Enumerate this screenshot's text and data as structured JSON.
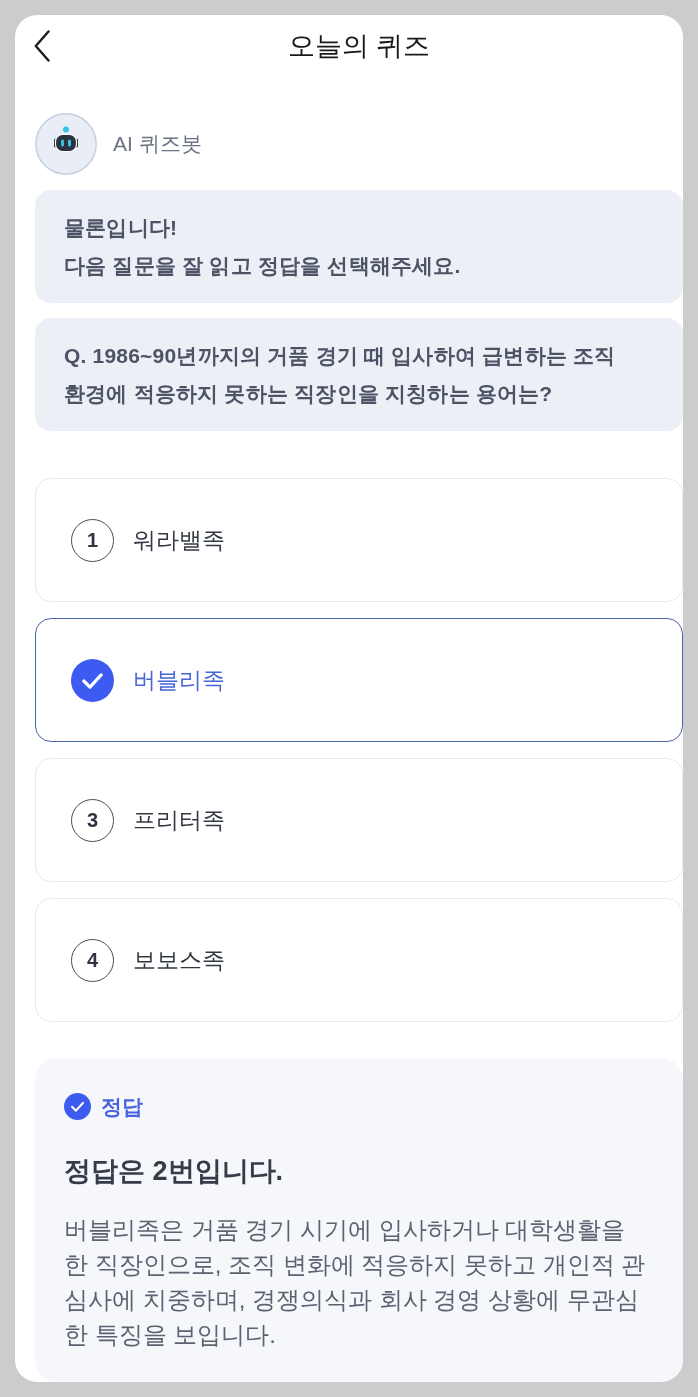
{
  "header": {
    "title": "오늘의 퀴즈"
  },
  "bot": {
    "name": "AI 퀴즈봇"
  },
  "messages": [
    {
      "text": "물론입니다!\n다음 질문을 잘 읽고 정답을 선택해주세요."
    },
    {
      "text": "Q. 1986~90년까지의 거품 경기 때 입사하여 급변하는 조직\n환경에 적응하지 못하는 직장인을 지칭하는 용어는?"
    }
  ],
  "options": [
    {
      "number": "1",
      "label": "워라밸족",
      "selected": false
    },
    {
      "label": "버블리족",
      "selected": true
    },
    {
      "number": "3",
      "label": "프리터족",
      "selected": false
    },
    {
      "number": "4",
      "label": "보보스족",
      "selected": false
    }
  ],
  "answer": {
    "badge": "정답",
    "title": "정답은 2번입니다.",
    "explanation": "버블리족은 거품 경기 시기에 입사하거나 대학생활을 한 직장인으로, 조직 변화에 적응하지 못하고 개인적 관심사에 치중하며, 경쟁의식과 회사 경영 상황에 무관심한 특징을 보입니다."
  }
}
